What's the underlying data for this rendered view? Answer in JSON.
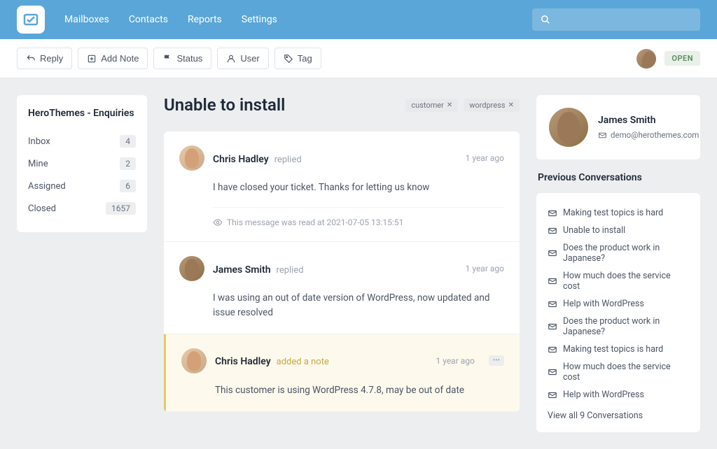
{
  "nav": {
    "items": [
      "Mailboxes",
      "Contacts",
      "Reports",
      "Settings"
    ]
  },
  "toolbar": {
    "reply": "Reply",
    "add_note": "Add Note",
    "status": "Status",
    "user": "User",
    "tag": "Tag",
    "status_badge": "OPEN"
  },
  "sidebar": {
    "title": "HeroThemes - Enquiries",
    "items": [
      {
        "label": "Inbox",
        "count": "4"
      },
      {
        "label": "Mine",
        "count": "2"
      },
      {
        "label": "Assigned",
        "count": "6"
      },
      {
        "label": "Closed",
        "count": "1657"
      }
    ]
  },
  "ticket": {
    "title": "Unable to install",
    "tags": [
      "customer",
      "wordpress"
    ]
  },
  "messages": [
    {
      "author": "Chris Hadley",
      "action": "replied",
      "time": "1 year ago",
      "body": "I have closed your ticket. Thanks for letting us know",
      "read_meta": "This message was read at 2021-07-05 13:15:51"
    },
    {
      "author": "James Smith",
      "action": "replied",
      "time": "1 year ago",
      "body": "I was using an out of date version of WordPress, now updated and issue resolved"
    },
    {
      "author": "Chris Hadley",
      "action": "added a note",
      "time": "1 year ago",
      "body": "This customer is using WordPress 4.7.8, may be out of date"
    }
  ],
  "customer": {
    "name": "James Smith",
    "email": "demo@herothemes.com"
  },
  "previous": {
    "title": "Previous Conversations",
    "items": [
      "Making test topics is hard",
      "Unable to install",
      "Does the product work in Japanese?",
      "How much does the service cost",
      "Help with WordPress",
      "Does the product work in Japanese?",
      "Making test topics is hard",
      "How much does the service cost",
      "Help with WordPress"
    ],
    "view_all": "View all 9 Conversations"
  }
}
